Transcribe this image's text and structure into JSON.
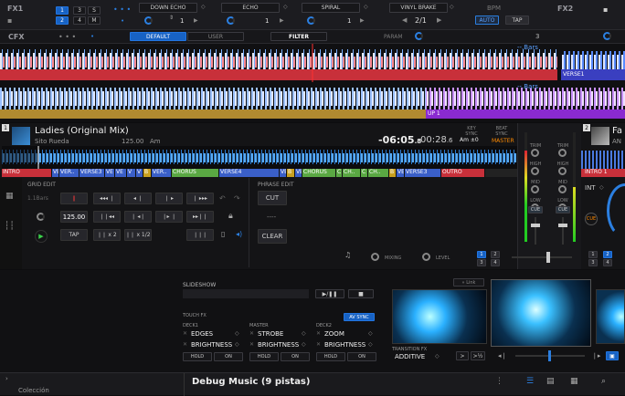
{
  "fx1": {
    "title": "FX1",
    "slots": [
      "1",
      "2",
      "3",
      "4",
      "S",
      "M"
    ],
    "dots": "• • •",
    "effects": [
      {
        "name": "DOWN ECHO",
        "value": "1"
      },
      {
        "name": "ECHO",
        "value": "1"
      },
      {
        "name": "SPIRAL",
        "value": "1"
      }
    ],
    "vinyl": "VINYL BRAKE",
    "beat": "2/1",
    "bpm_label": "BPM",
    "auto": "AUTO",
    "tap": "TAP"
  },
  "fx2": {
    "title": "FX2"
  },
  "cfx": {
    "title": "CFX",
    "dots": "• • •",
    "default": "DEFAULT",
    "user": "USER",
    "filter": "FILTER",
    "param": "PARAM",
    "num": "3"
  },
  "overview": {
    "bars_label1": "--.Bars",
    "bars_label2": "--.Bars",
    "marker1": "VERSE1",
    "marker2": "UP 1"
  },
  "deck1": {
    "num": "1",
    "title": "Ladies (Original Mix)",
    "artist": "Sito Rueda",
    "bpm": "125.00",
    "key": "Am",
    "key_sync_label": "KEY SYNC",
    "key_sync_val": "Am",
    "key_sync_offset": "±0",
    "beat_sync_label": "BEAT SYNC",
    "master": "MASTER",
    "remain": "-06:05",
    "remain_dec": ".8",
    "elapsed": "00:28",
    "elapsed_dec": ".6",
    "phrases": [
      {
        "t": "INTRO",
        "c": "#c8303a",
        "w": 55
      },
      {
        "t": "VE",
        "c": "#3a5fc8",
        "w": 8
      },
      {
        "t": "VER..",
        "c": "#3a5fc8",
        "w": 22
      },
      {
        "t": "VERSE3",
        "c": "#3a5fc8",
        "w": 28
      },
      {
        "t": "VE",
        "c": "#3a5fc8",
        "w": 11
      },
      {
        "t": "VE",
        "c": "#3a5fc8",
        "w": 13
      },
      {
        "t": "V",
        "c": "#3a5fc8",
        "w": 10
      },
      {
        "t": "V",
        "c": "#3a5fc8",
        "w": 8
      },
      {
        "t": "B",
        "c": "#c8a020",
        "w": 9
      },
      {
        "t": "VER..",
        "c": "#3a5fc8",
        "w": 22
      },
      {
        "t": "CHORUS",
        "c": "#5aa843",
        "w": 52
      },
      {
        "t": "VERSE4",
        "c": "#3a5fc8",
        "w": 66
      },
      {
        "t": "VE",
        "c": "#3a5fc8",
        "w": 8
      },
      {
        "t": "B",
        "c": "#c8a020",
        "w": 9
      },
      {
        "t": "VE",
        "c": "#3a5fc8",
        "w": 8
      },
      {
        "t": "CHORUS",
        "c": "#5aa843",
        "w": 37
      },
      {
        "t": "C",
        "c": "#5aa843",
        "w": 7
      },
      {
        "t": "CH..",
        "c": "#5aa843",
        "w": 20
      },
      {
        "t": "C",
        "c": "#5aa843",
        "w": 8
      },
      {
        "t": "CH..",
        "c": "#5aa843",
        "w": 23
      },
      {
        "t": "B",
        "c": "#c8a020",
        "w": 8
      },
      {
        "t": "VE",
        "c": "#3a5fc8",
        "w": 9
      },
      {
        "t": "VERSE3",
        "c": "#3a5fc8",
        "w": 40
      },
      {
        "t": "OUTRO",
        "c": "#c8303a",
        "w": 48
      }
    ]
  },
  "grid": {
    "title": "GRID EDIT",
    "bars": "1.1Bars",
    "bpm": "125.00",
    "tap": "TAP",
    "x2": "x 2",
    "half": "x 1/2"
  },
  "phrase": {
    "title": "PHRASE EDIT",
    "cut": "CUT",
    "dash": "----",
    "clear": "CLEAR"
  },
  "mixer": {
    "trim": "TRIM",
    "hi": "HIGH",
    "mid": "MID",
    "low": "LOW",
    "cue": "CUE",
    "cue_btn": "CUE",
    "mixing": "MIXING",
    "level": "LEVEL"
  },
  "deck2": {
    "num": "2",
    "title": "Fa",
    "artist": "AN",
    "intro": "INTRO 1",
    "int": "INT"
  },
  "slideshow": {
    "title": "SLIDESHOW"
  },
  "touchfx": {
    "title": "TOUCH FX",
    "av_sync": "AV SYNC",
    "deck1_label": "DECK1",
    "master_label": "MASTER",
    "deck2_label": "DECK2",
    "fx": [
      {
        "a": "EDGES",
        "b": "BRIGHTNESS"
      },
      {
        "a": "STROBE",
        "b": "BRIGHTNESS"
      },
      {
        "a": "ZOOM",
        "b": "BRIGHTNESS"
      }
    ],
    "hold": "HOLD",
    "on": "ON"
  },
  "transition": {
    "label": "TRANSITION FX",
    "value": "ADDITIVE"
  },
  "video": {
    "link": "» Link"
  },
  "library": {
    "title": "Debug Music (9 pistas)",
    "side": "Colección"
  },
  "colors": {
    "accent": "#1a6bd6",
    "deck1_wave": "#e0404a",
    "deck2_wave": "#5a8cff"
  }
}
